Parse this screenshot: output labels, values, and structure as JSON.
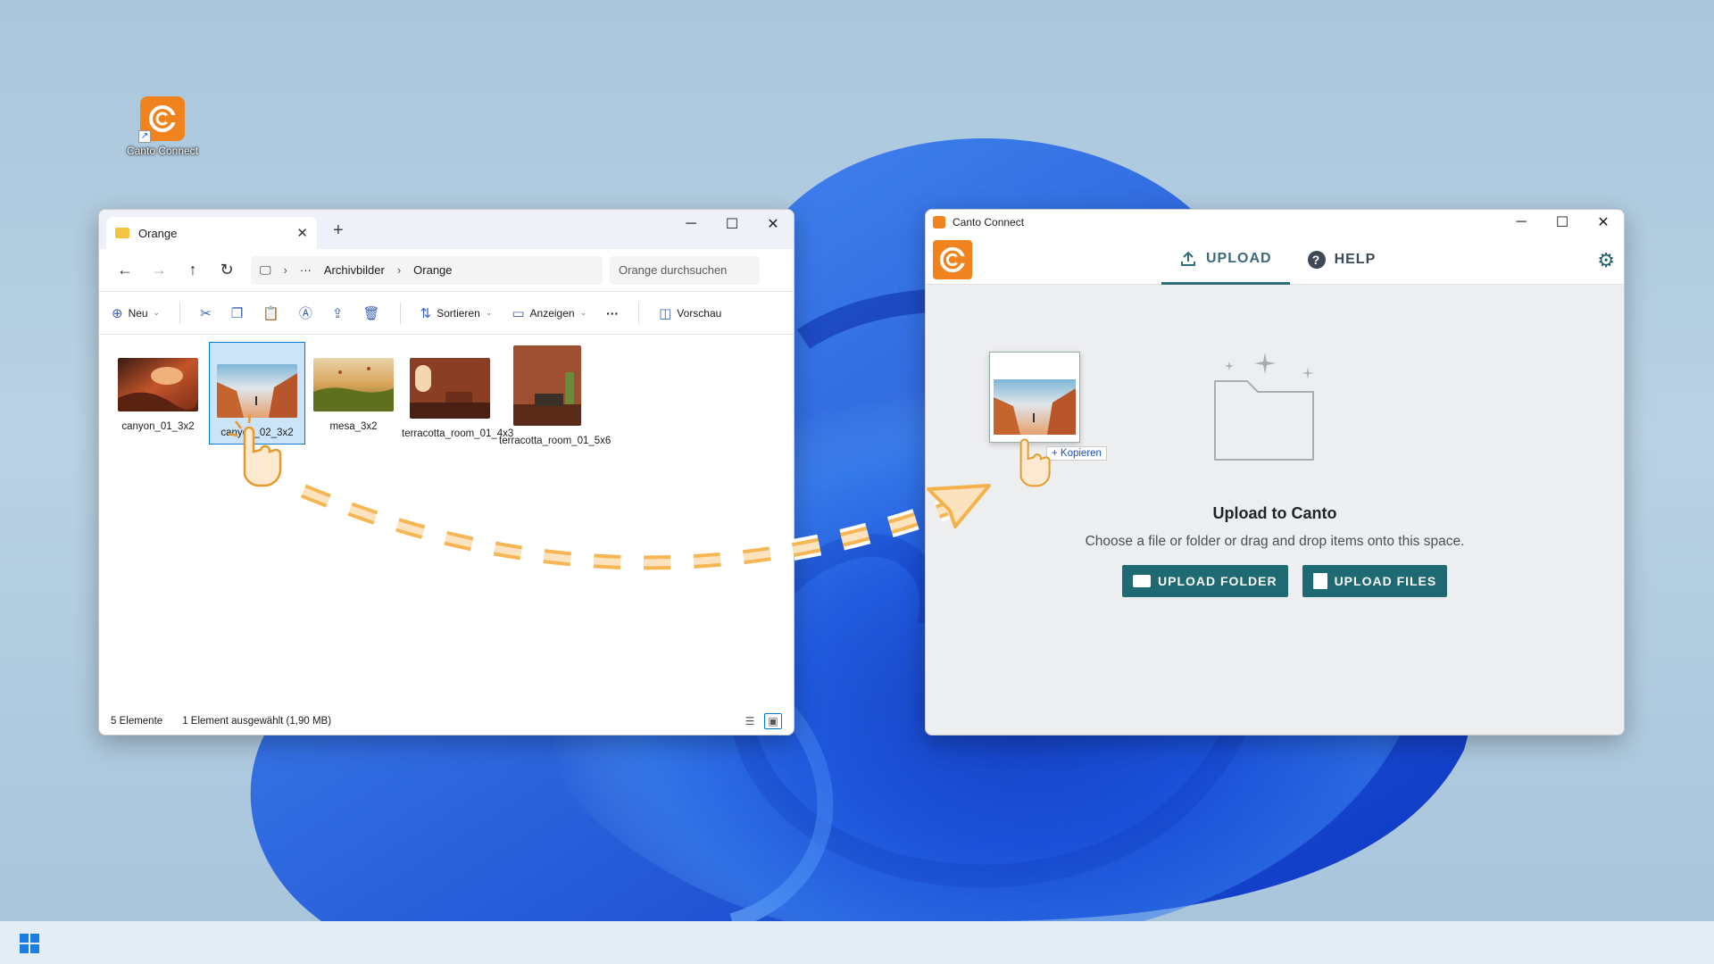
{
  "desktop": {
    "icon_label": "Canto Connect"
  },
  "explorer": {
    "tab_title": "Orange",
    "breadcrumb": [
      "Archivbilder",
      "Orange"
    ],
    "search_placeholder": "Orange durchsuchen",
    "toolbar": {
      "new_label": "Neu",
      "sort_label": "Sortieren",
      "view_label": "Anzeigen",
      "more_label": "···",
      "preview_label": "Vorschau"
    },
    "files": [
      {
        "name": "canyon_01_3x2",
        "selected": false
      },
      {
        "name": "canyon_02_3x2",
        "selected": true
      },
      {
        "name": "mesa_3x2",
        "selected": false
      },
      {
        "name": "terracotta_room_01_4x3",
        "selected": false
      },
      {
        "name": "terracotta_room_01_5x6",
        "selected": false
      }
    ],
    "status": {
      "count": "5 Elemente",
      "selection": "1 Element ausgewählt (1,90 MB)"
    }
  },
  "canto": {
    "window_title": "Canto Connect",
    "tabs": [
      {
        "label": "UPLOAD",
        "active": true
      },
      {
        "label": "HELP",
        "active": false
      }
    ],
    "heading": "Upload to Canto",
    "subtitle": "Choose a file or folder or drag and drop items onto this space.",
    "upload_folder_label": "UPLOAD FOLDER",
    "upload_files_label": "UPLOAD FILES",
    "drag_tooltip": "+ Kopieren"
  },
  "colors": {
    "canto_orange": "#f0831e",
    "canto_teal": "#1f6a72",
    "selection_blue": "#0078d4",
    "drag_arrow": "#f5b24a"
  },
  "icons": [
    "start-icon",
    "gear-icon",
    "upload-icon",
    "help-icon",
    "folder-icon",
    "file-icon",
    "hand-cursor-icon"
  ]
}
